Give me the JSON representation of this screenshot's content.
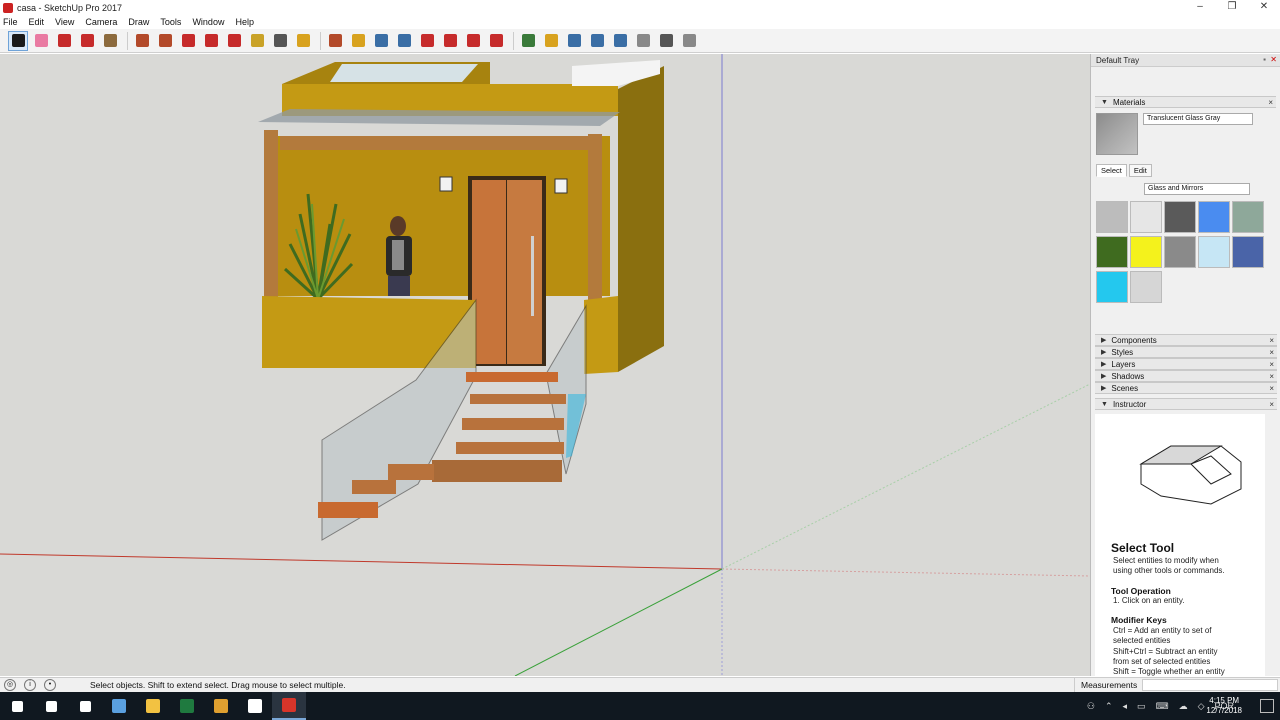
{
  "window": {
    "title": "casa - SketchUp Pro 2017",
    "controls": [
      "–",
      "❐",
      "✕"
    ]
  },
  "menu": [
    "File",
    "Edit",
    "View",
    "Camera",
    "Draw",
    "Tools",
    "Window",
    "Help"
  ],
  "toolbar": {
    "tools": [
      {
        "name": "select-tool",
        "color": "#1a1a1a"
      },
      {
        "name": "eraser-tool",
        "color": "#e97aa2"
      },
      {
        "name": "line-tool",
        "color": "#c62b2b"
      },
      {
        "name": "arc-tool",
        "color": "#c62b2b"
      },
      {
        "name": "rectangle-tool",
        "color": "#8c6a3d"
      },
      {
        "name": "push-pull-tool",
        "color": "#b34a2a"
      },
      {
        "name": "offset-tool",
        "color": "#b34a2a"
      },
      {
        "name": "move-tool",
        "color": "#c62b2b"
      },
      {
        "name": "rotate-tool",
        "color": "#c62b2b"
      },
      {
        "name": "scale-tool",
        "color": "#c62b2b"
      },
      {
        "name": "tape-measure-tool",
        "color": "#c9a227"
      },
      {
        "name": "text-tool",
        "color": "#555555"
      },
      {
        "name": "paint-bucket-tool",
        "color": "#d8a21e"
      },
      {
        "name": "orbit-tool",
        "color": "#b34a2a"
      },
      {
        "name": "pan-tool",
        "color": "#d8a21e"
      },
      {
        "name": "zoom-tool",
        "color": "#3a6ea5"
      },
      {
        "name": "zoom-extents-tool",
        "color": "#3a6ea5"
      },
      {
        "name": "warehouse-tool",
        "color": "#c62b2b"
      },
      {
        "name": "extension-tool",
        "color": "#c62b2b"
      },
      {
        "name": "layout-tool",
        "color": "#c62b2b"
      },
      {
        "name": "ruby-tool",
        "color": "#c62b2b"
      },
      {
        "name": "orbit-view-tool",
        "color": "#3a7a3a"
      },
      {
        "name": "pan-view-tool",
        "color": "#d8a21e"
      },
      {
        "name": "zoom-view-tool",
        "color": "#3a6ea5"
      },
      {
        "name": "zoom-window-tool",
        "color": "#3a6ea5"
      },
      {
        "name": "zoom-fit-tool",
        "color": "#3a6ea5"
      },
      {
        "name": "position-camera-tool",
        "color": "#888888"
      },
      {
        "name": "look-around-tool",
        "color": "#555555"
      },
      {
        "name": "walk-tool",
        "color": "#888888"
      }
    ]
  },
  "tray": {
    "title": "Default Tray",
    "materials": {
      "header": "Materials",
      "current_name": "Translucent Glass Gray",
      "tabs": [
        "Select",
        "Edit"
      ],
      "collection": "Glass and Mirrors",
      "swatch_colors": [
        "#bcbcbc",
        "#e6e6e6",
        "#5a5a5a",
        "#4a8cf0",
        "#8ea89a",
        "#3f6b1f",
        "#f4f21c",
        "#8a8a8a",
        "#c6e6f5",
        "#4a64a8",
        "#24c8ee",
        "#d6d6d6"
      ]
    },
    "collapsed_sections": [
      "Components",
      "Styles",
      "Layers",
      "Shadows",
      "Scenes"
    ],
    "instructor": {
      "header": "Instructor",
      "tool_title": "Select Tool",
      "tool_desc_1": "Select entities to modify when",
      "tool_desc_2": "using other tools or commands.",
      "op_heading": "Tool Operation",
      "op_1": "1. Click on an entity.",
      "mod_heading": "Modifier Keys",
      "mod_1": "Ctrl = Add an entity to set of",
      "mod_2": "selected entities",
      "mod_3": "Shift+Ctrl = Subtract an entity",
      "mod_4": "from set of selected entities",
      "mod_5": "Shift = Toggle whether an entity"
    }
  },
  "status": {
    "hint": "Select objects. Shift to extend select. Drag mouse to select multiple.",
    "measurements_label": "Measurements"
  },
  "taskbar": {
    "apps": [
      {
        "name": "start",
        "color": "#ffffff"
      },
      {
        "name": "search",
        "color": "#ffffff"
      },
      {
        "name": "task-view",
        "color": "#ffffff"
      },
      {
        "name": "app-settings",
        "color": "#5aa0e0"
      },
      {
        "name": "file-explorer",
        "color": "#f2c242"
      },
      {
        "name": "excel",
        "color": "#1f7a3f"
      },
      {
        "name": "chrome",
        "color": "#e0a030"
      },
      {
        "name": "photos",
        "color": "#ffffff"
      },
      {
        "name": "sketchup",
        "color": "#d8352a"
      }
    ],
    "language": "POR",
    "time": "4:15 PM",
    "date": "12/7/2018"
  }
}
